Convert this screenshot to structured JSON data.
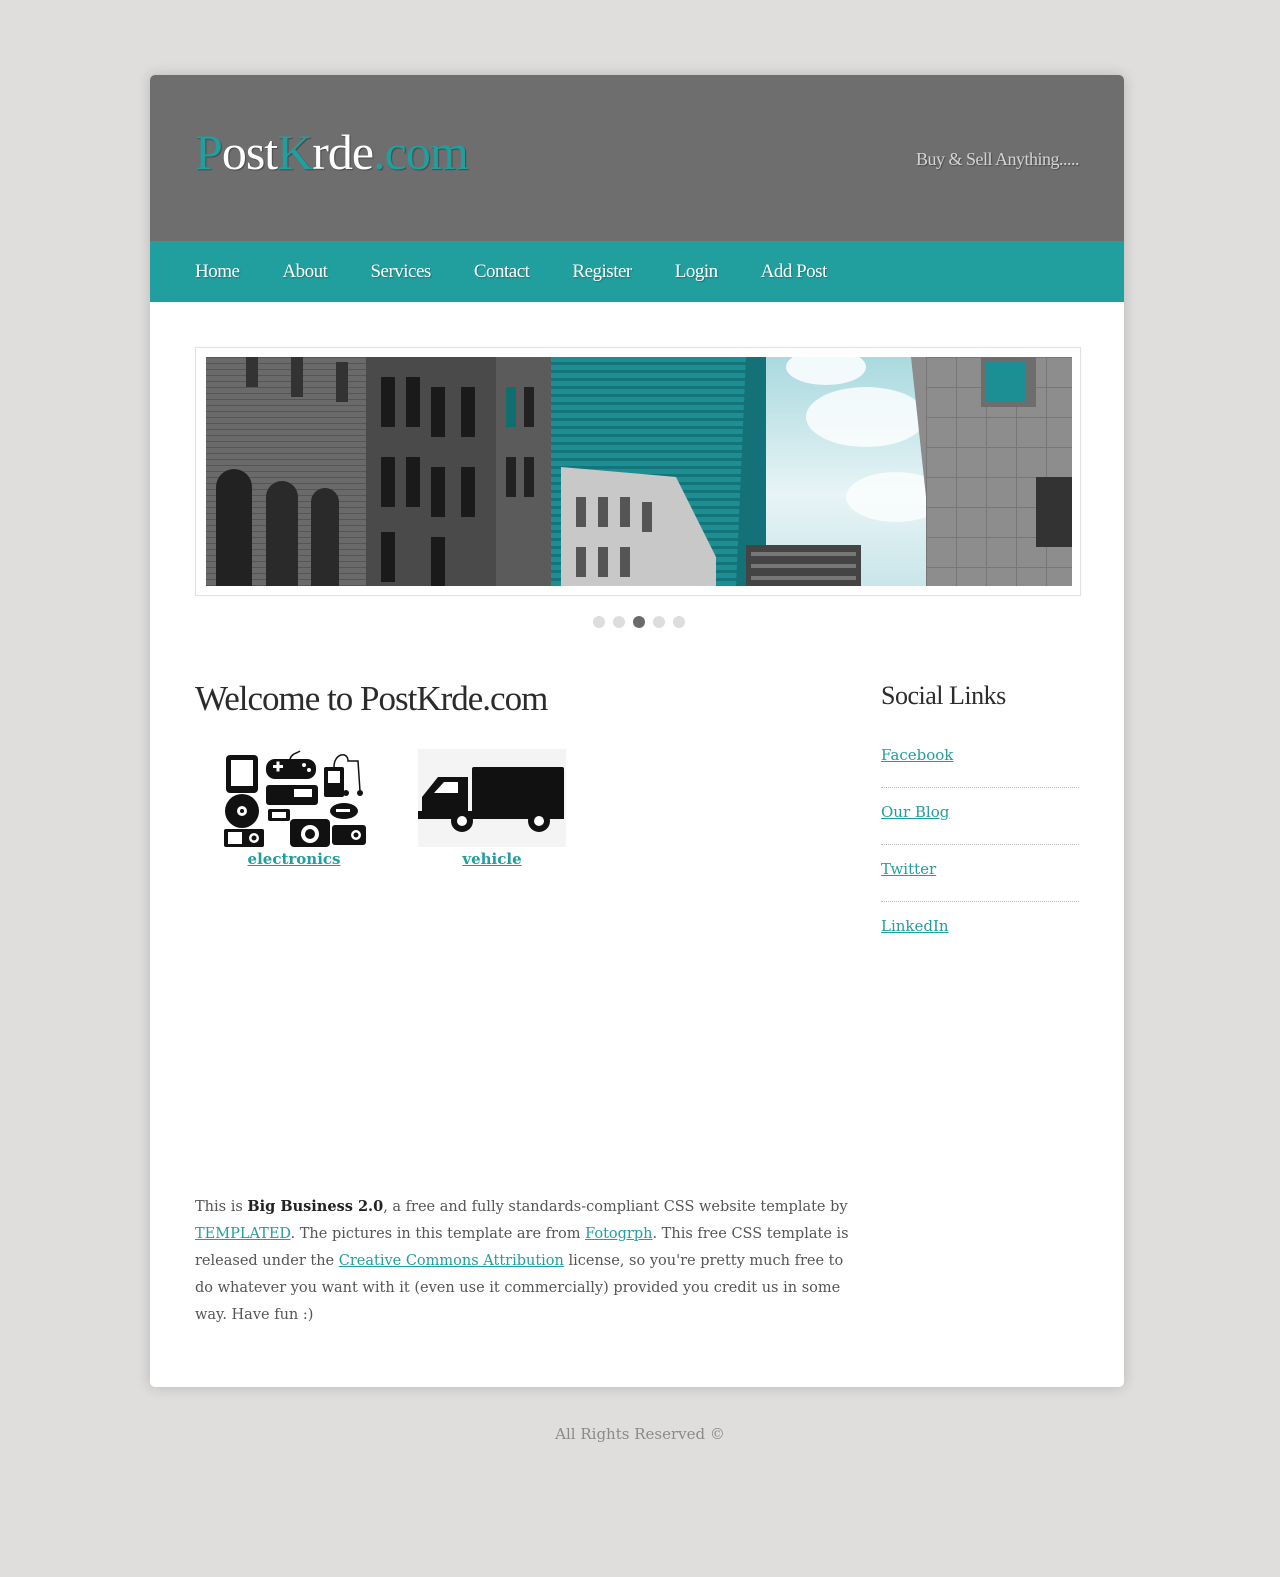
{
  "colors": {
    "accent": "#219e9e",
    "header_bg": "#6e6e6e",
    "page_bg": "#e0dedd"
  },
  "header": {
    "logo_parts": [
      "P",
      "ost",
      "K",
      "rde",
      ".com"
    ],
    "tagline": "Buy & Sell Anything....."
  },
  "nav": {
    "items": [
      "Home",
      "About",
      "Services",
      "Contact",
      "Register",
      "Login",
      "Add Post"
    ]
  },
  "slider": {
    "slide_count": 5,
    "active_index": 2
  },
  "main": {
    "title": "Welcome to PostKrde.com",
    "categories": [
      {
        "label": "electronics",
        "icon": "electronics-icon"
      },
      {
        "label": "vehicle",
        "icon": "truck-icon"
      }
    ],
    "about": {
      "t1": "This is ",
      "b1": "Big Business 2.0",
      "t2": ", a free and fully standards-compliant CSS website template by ",
      "l1": "TEMPLATED",
      "t3": ". The pictures in this template are from ",
      "l2": "Fotogrph",
      "t4": ". This free CSS template is released under the ",
      "l3": "Creative Commons Attribution",
      "t5": " license, so you're pretty much free to do whatever you want with it (even use it commercially) provided you credit us in some way. Have fun :)"
    }
  },
  "sidebar": {
    "title": "Social Links",
    "links": [
      "Facebook",
      "Our Blog",
      "Twitter",
      "LinkedIn"
    ]
  },
  "footer": {
    "text": "All Rights Reserved ©"
  }
}
